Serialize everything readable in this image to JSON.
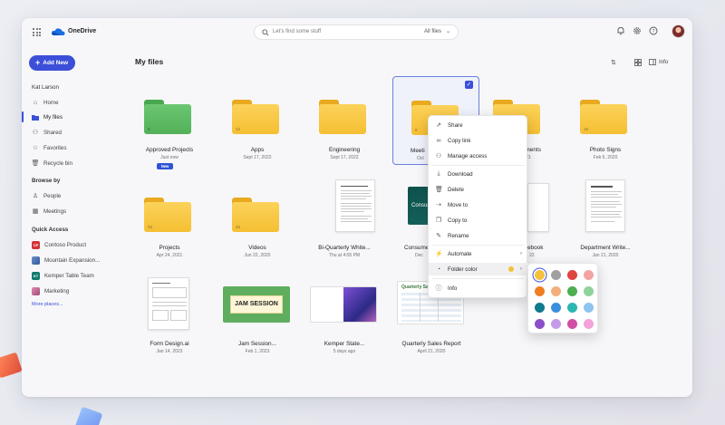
{
  "app": {
    "title": "OneDrive"
  },
  "search": {
    "placeholder": "Let's find some stuff",
    "filter": "All files"
  },
  "topbar_icons": [
    "bell-icon",
    "gear-icon",
    "help-icon"
  ],
  "sidebar": {
    "add_new": "Add New",
    "user": "Kat Larson",
    "items": [
      {
        "label": "Home",
        "icon": "home-icon"
      },
      {
        "label": "My files",
        "icon": "folder-icon",
        "active": true
      },
      {
        "label": "Shared",
        "icon": "people-icon"
      },
      {
        "label": "Favorites",
        "icon": "star-icon"
      },
      {
        "label": "Recycle bin",
        "icon": "trash-icon"
      }
    ],
    "browse_by": "Browse by",
    "browse_items": [
      {
        "label": "People",
        "icon": "person-icon"
      },
      {
        "label": "Meetings",
        "icon": "calendar-icon"
      }
    ],
    "quick_access": "Quick Access",
    "quick_items": [
      {
        "label": "Contoso Product",
        "abbr": "CP",
        "color": "#d13438"
      },
      {
        "label": "Mountain Expansion...",
        "abbr": "",
        "color": "#6b8fc9"
      },
      {
        "label": "Kemper Table Team",
        "abbr": "KT",
        "color": "#0f7b6c"
      },
      {
        "label": "Marketing",
        "abbr": "",
        "color": "#c75a8c"
      }
    ],
    "more_places": "More places..."
  },
  "main": {
    "title": "My files",
    "view_label": "Info",
    "files": [
      {
        "name": "Approved Projects",
        "meta": "Just now",
        "badge": "New",
        "count": "8",
        "kind": "folder",
        "color": "#5dbb63"
      },
      {
        "name": "Apps",
        "meta": "Sept 17, 2022",
        "count": "12",
        "kind": "folder",
        "color": "#f5c13c"
      },
      {
        "name": "Engineering",
        "meta": "Sept 17, 2022",
        "count": "",
        "kind": "folder",
        "color": "#f5c13c"
      },
      {
        "name": "Meeti",
        "meta": "Oct",
        "count": "8",
        "kind": "folder",
        "color": "#f5c13c",
        "selected": true
      },
      {
        "name": "uments",
        "meta": "21",
        "count": "",
        "kind": "folder",
        "color": "#f5c13c"
      },
      {
        "name": "Photo Signs",
        "meta": "Feb 6, 2020",
        "count": "19",
        "kind": "folder",
        "color": "#f5c13c"
      },
      {
        "name": "Projects",
        "meta": "Apr 24, 2021",
        "count": "33",
        "kind": "folder",
        "color": "#f5c13c"
      },
      {
        "name": "Videos",
        "meta": "Jun 22, 2020",
        "count": "46",
        "kind": "folder",
        "color": "#f5c13c"
      },
      {
        "name": "Bi-Quarterly White...",
        "meta": "Thu at 4:05 PM",
        "kind": "doc"
      },
      {
        "name": "Consumer",
        "meta": "Dec",
        "kind": "slide",
        "thumb_text": "Consum"
      },
      {
        "name": "ebook",
        "meta": "22",
        "kind": "doc"
      },
      {
        "name": "Department Write...",
        "meta": "Jan 21, 2020",
        "kind": "doc"
      },
      {
        "name": "Form Design.ai",
        "meta": "Jan 14, 2023",
        "kind": "form"
      },
      {
        "name": "Jam Session...",
        "meta": "Feb 1, 2023",
        "kind": "jam",
        "thumb_text": "JAM SESSION"
      },
      {
        "name": "Kemper State...",
        "meta": "5 days ago",
        "kind": "deck"
      },
      {
        "name": "Quarterly Sales Report",
        "meta": "April 21, 2020",
        "kind": "sheet",
        "thumb_text": "Quarterly Sales Report"
      }
    ]
  },
  "context_menu": {
    "items": [
      {
        "label": "Share",
        "icon": "share-icon"
      },
      {
        "label": "Copy link",
        "icon": "link-icon"
      },
      {
        "label": "Manage access",
        "icon": "people-icon"
      },
      {
        "label": "Download",
        "icon": "download-icon"
      },
      {
        "label": "Delete",
        "icon": "trash-icon"
      },
      {
        "label": "Move to",
        "icon": "move-icon"
      },
      {
        "label": "Copy to",
        "icon": "copy-icon"
      },
      {
        "label": "Rename",
        "icon": "rename-icon"
      },
      {
        "label": "Automate",
        "icon": "automate-icon",
        "submenu": true
      },
      {
        "label": "Folder color",
        "icon": "palette-icon",
        "submenu": true,
        "hover": true
      },
      {
        "label": "Info",
        "icon": "info-icon"
      }
    ]
  },
  "folder_colors": {
    "selected": "#f5c13c",
    "swatches": [
      "#f5c13c",
      "#a0a0a0",
      "#e0443e",
      "#f4a3a3",
      "#ef7d22",
      "#f3b07c",
      "#4caf50",
      "#8ed39a",
      "#0f7b8c",
      "#3a8fdc",
      "#2db6b0",
      "#8fc3f0",
      "#8b4fc9",
      "#c59be8",
      "#d24fa6",
      "#f2a3d8"
    ]
  }
}
